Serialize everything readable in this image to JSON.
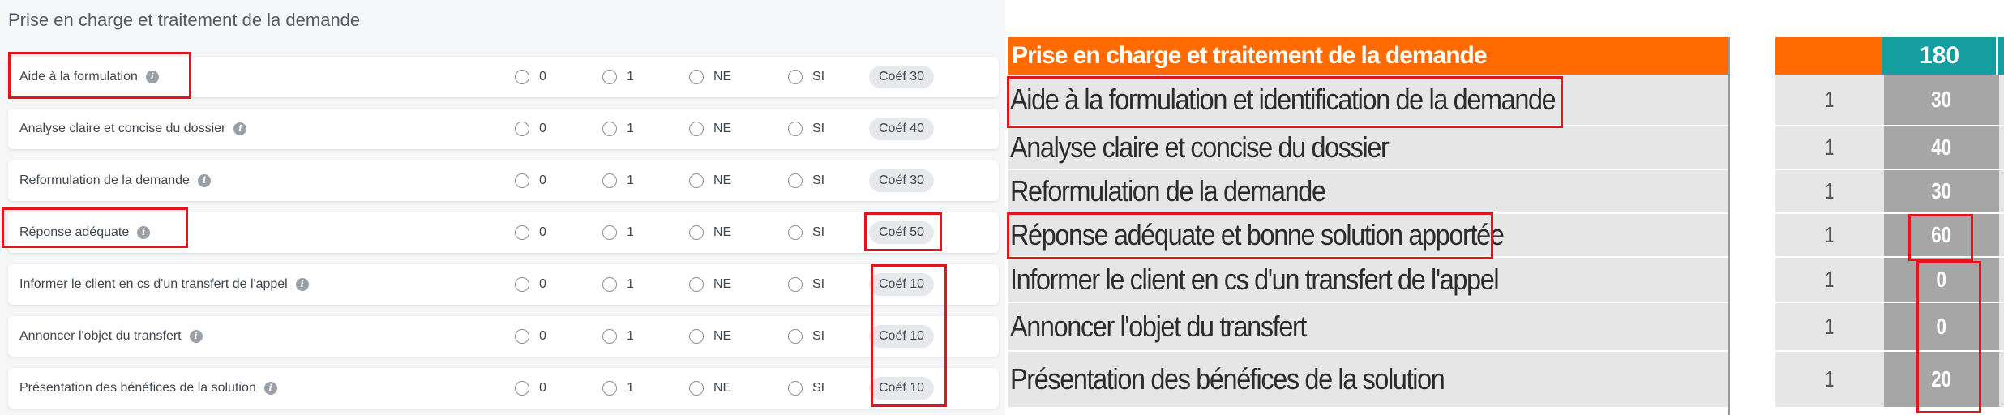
{
  "form": {
    "title": "Prise en charge et traitement de la demande",
    "options": [
      "0",
      "1",
      "NE",
      "SI"
    ],
    "rows": [
      {
        "label": "Aide à la formulation",
        "coef": "Coéf 30"
      },
      {
        "label": "Analyse claire et concise du dossier",
        "coef": "Coéf 40"
      },
      {
        "label": "Reformulation de la demande",
        "coef": "Coéf 30"
      },
      {
        "label": "Réponse adéquate",
        "coef": "Coéf 50"
      },
      {
        "label": "Informer le client en cs d'un transfert de l'appel",
        "coef": "Coéf 10"
      },
      {
        "label": "Annoncer l'objet du transfert",
        "coef": "Coéf 10"
      },
      {
        "label": "Présentation des bénéfices de la solution",
        "coef": "Coéf 10"
      }
    ]
  },
  "sheet": {
    "header": "Prise en charge et traitement de la demande",
    "total": "180",
    "rows": [
      {
        "label": "Aide à la formulation et identification de la demande",
        "count": "1",
        "value": "30"
      },
      {
        "label": "Analyse claire et concise du dossier",
        "count": "1",
        "value": "40"
      },
      {
        "label": "Reformulation de la demande",
        "count": "1",
        "value": "30"
      },
      {
        "label": "Réponse adéquate et bonne solution apportée",
        "count": "1",
        "value": "60"
      },
      {
        "label": "Informer le client en cs d'un transfert de l'appel",
        "count": "1",
        "value": "0"
      },
      {
        "label": "Annoncer l'objet du transfert",
        "count": "1",
        "value": "0"
      },
      {
        "label": "Présentation des bénéfices de la solution",
        "count": "1",
        "value": "20"
      }
    ]
  },
  "colors": {
    "highlight": "#e2141c",
    "sheet_header": "#ff6b00",
    "sheet_total": "#149ea1"
  }
}
